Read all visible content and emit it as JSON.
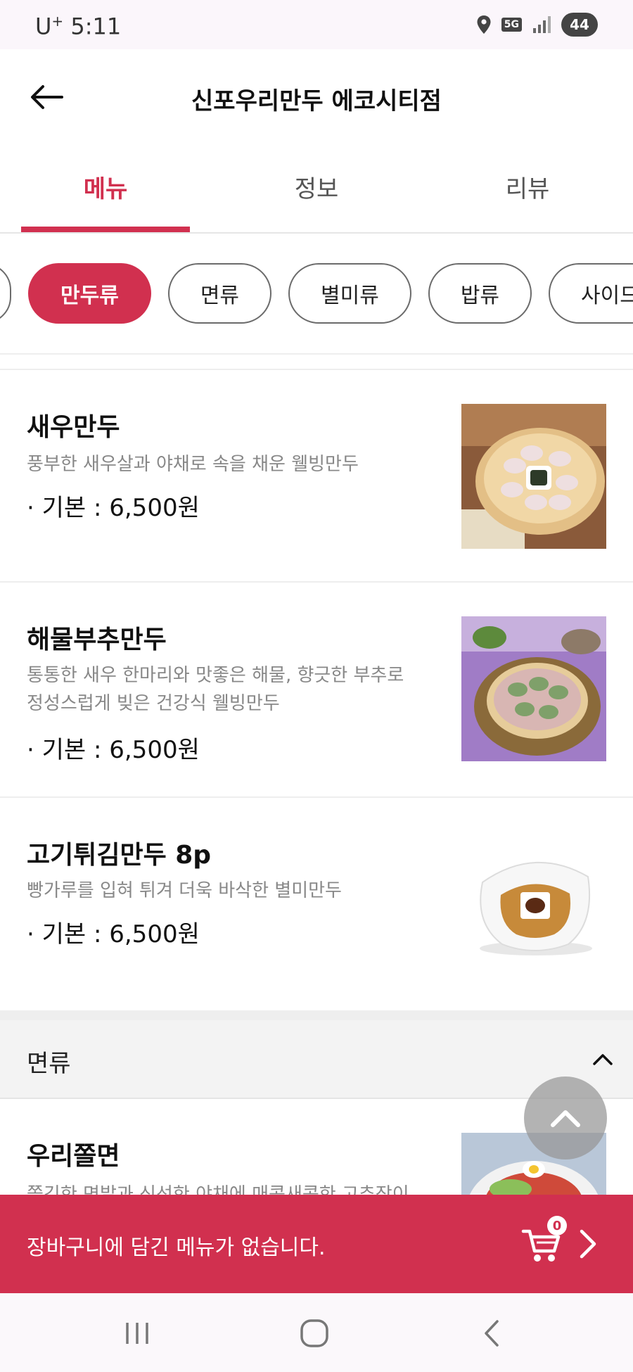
{
  "status_bar": {
    "carrier": "U",
    "carrier_sup": "+",
    "time": "5:11",
    "network": "5G",
    "battery": "44"
  },
  "header": {
    "title": "신포우리만두 에코시티점"
  },
  "tabs": [
    {
      "label": "메뉴",
      "active": true
    },
    {
      "label": "정보",
      "active": false
    },
    {
      "label": "리뷰",
      "active": false
    }
  ],
  "categories": [
    {
      "label": "",
      "active": false
    },
    {
      "label": "만두류",
      "active": true
    },
    {
      "label": "면류",
      "active": false
    },
    {
      "label": "별미류",
      "active": false
    },
    {
      "label": "밥류",
      "active": false
    },
    {
      "label": "사이드",
      "active": false
    }
  ],
  "menu_items": [
    {
      "name": "새우만두",
      "description_lines": [
        "풍부한 새우살과 야채로 속을 채운 웰빙만두"
      ],
      "price": "· 기본 : 6,500원"
    },
    {
      "name": "해물부추만두",
      "description_lines": [
        "통통한 새우 한마리와 맛좋은 해물, 향긋한 부추로",
        "정성스럽게 빚은 건강식 웰빙만두"
      ],
      "price": "· 기본 : 6,500원"
    },
    {
      "name": "고기튀김만두 8p",
      "description_lines": [
        "빵가루를 입혀 튀겨 더욱 바삭한 별미만두"
      ],
      "price": "· 기본 : 6,500원"
    }
  ],
  "section": {
    "title": "면류",
    "first_item_name": "우리쫄면",
    "first_item_description": "쫄깃한 면발과 신선한 야채에 매콤새콤한 고추장이"
  },
  "cart": {
    "message": "장바구니에 담긴 메뉴가 없습니다.",
    "count": "0"
  },
  "colors": {
    "accent": "#d1304f",
    "section_bg": "#f3f3f3"
  }
}
